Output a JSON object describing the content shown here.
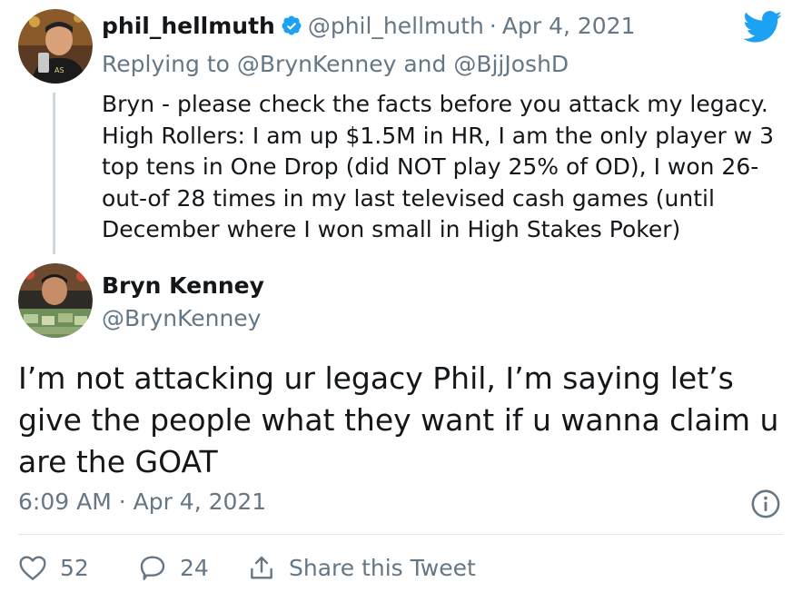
{
  "reply_tweet": {
    "author_name": "phil_hellmuth",
    "handle": "@phil_hellmuth",
    "separator": "·",
    "date": "Apr 4, 2021",
    "replying_prefix": "Replying to",
    "mention_1": "@BrynKenney",
    "conjunction": "and",
    "mention_2": "@BjjJoshD",
    "text": "Bryn - please check the facts before you attack my legacy. High Rollers: I am up $1.5M in HR, I am the only player w 3 top tens in One Drop (did NOT play 25% of OD), I won 26-out-of 28 times in my last televised cash games (until December where I won small in High Stakes Poker)"
  },
  "main_tweet": {
    "author_name": "Bryn Kenney",
    "handle": "@BrynKenney",
    "text": "I’m not attacking ur legacy Phil, I’m saying let’s give the people what they want if u wanna claim u are the GOAT",
    "timestamp": "6:09 AM · Apr 4, 2021"
  },
  "actions": {
    "likes": "52",
    "replies": "24",
    "share_label": "Share this Tweet"
  },
  "icons": {
    "brand": "twitter-bird-icon",
    "verified": "verified-badge-icon",
    "info": "info-icon",
    "like": "heart-icon",
    "reply": "reply-bubble-icon",
    "share": "share-icon"
  },
  "colors": {
    "brand": "#1da1f2",
    "secondary_text": "#657786",
    "primary_text": "#14171a",
    "divider": "#e1e8ed"
  }
}
